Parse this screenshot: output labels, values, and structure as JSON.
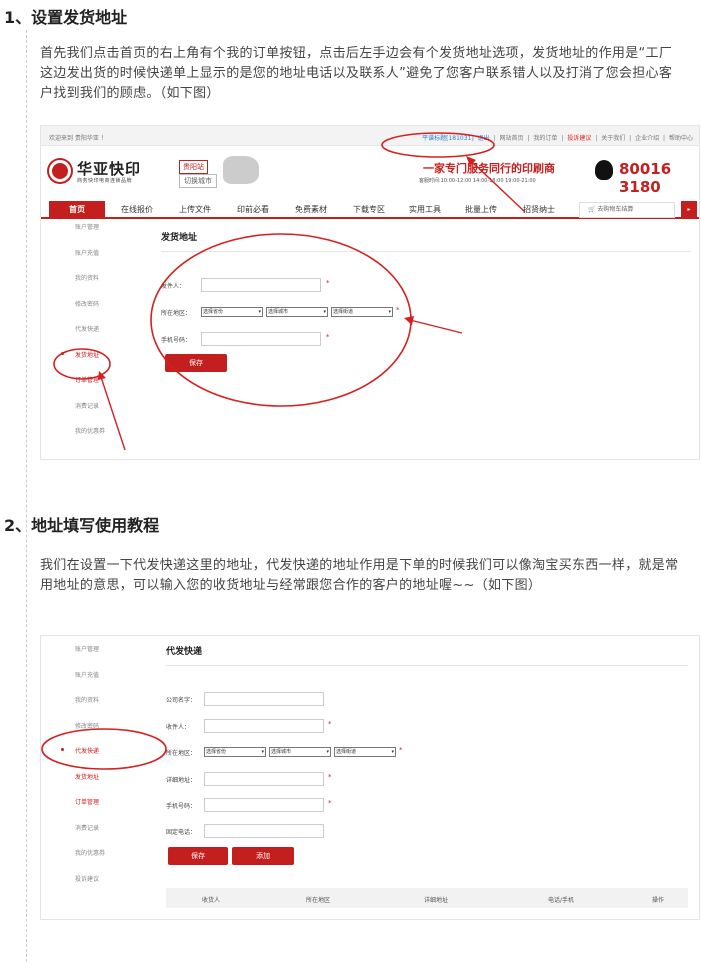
{
  "section1": {
    "title": "1、设置发货地址",
    "body": "首先我们点击首页的右上角有个我的订单按钮，点击后左手边会有个发货地址选项，发货地址的作用是“工厂这边发出货的时候快递单上显示的是您的地址电话以及联系人”避免了您客户联系错人以及打消了您会担心客户找到我们的顾虑。（如下图）"
  },
  "section2": {
    "title": "2、地址填写使用教程",
    "body": "我们在设置一下代发快递这里的地址，代发快递的地址作用是下单的时候我们可以像淘宝买东西一样，就是常用地址的意思，可以输入您的收货地址与经常跟您合作的客户的地址喔~~（如下图）"
  },
  "shot1": {
    "topbar": {
      "welcome": "欢迎来到 贵阳华亚 ！",
      "links": [
        "平谱标题[181031]",
        "退出",
        "|",
        "网站首页",
        "|",
        "我的订单",
        "|",
        "投诉建议",
        "|",
        "关于我们",
        "|",
        "企业介绍",
        "|",
        "帮助中心"
      ]
    },
    "brand": {
      "name": "华亚快印",
      "sub": "商务快印电商连锁品牌",
      "site": "贵阳站",
      "switch": "切换城市"
    },
    "slogan": "一家专门服务同行的印刷商",
    "hours": "客服时间:10:00-12:00 14:00-18:00 19:00-21:00",
    "phone": "80016 3180",
    "nav": [
      "首页",
      "在线报价",
      "上传文件",
      "印前必看",
      "免费素材",
      "下载专区",
      "实用工具",
      "批量上传",
      "招贤纳士"
    ],
    "cart": "去购物车结算",
    "sidebar": [
      "账户管理",
      "账户充值",
      "我的资料",
      "修改密码",
      "代发快递",
      "发货地址",
      "订单管理",
      "消费记录",
      "我的优惠券"
    ],
    "content_title": "发货地址",
    "fields": {
      "sender": "发件人：",
      "area": "所在地区：",
      "phone": "手机号码："
    },
    "selects": [
      "选择省份",
      "选择城市",
      "选择街道"
    ],
    "save": "保存"
  },
  "shot2": {
    "sidebar": [
      "账户管理",
      "账户充值",
      "我的资料",
      "修改密码",
      "代发快递",
      "发货地址",
      "订单管理",
      "消费记录",
      "我的优惠券",
      "投诉建议"
    ],
    "content_title": "代发快递",
    "fields": {
      "company": "公司名字：",
      "receiver": "收件人：",
      "area": "所在地区：",
      "address": "详细地址：",
      "mobile": "手机号码：",
      "tel": "固定电话："
    },
    "selects": [
      "选择省份",
      "选择城市",
      "选择街道"
    ],
    "save": "保存",
    "add": "添加",
    "table_headers": [
      "收货人",
      "所在地区",
      "详细地址",
      "电话/手机",
      "操作"
    ]
  }
}
